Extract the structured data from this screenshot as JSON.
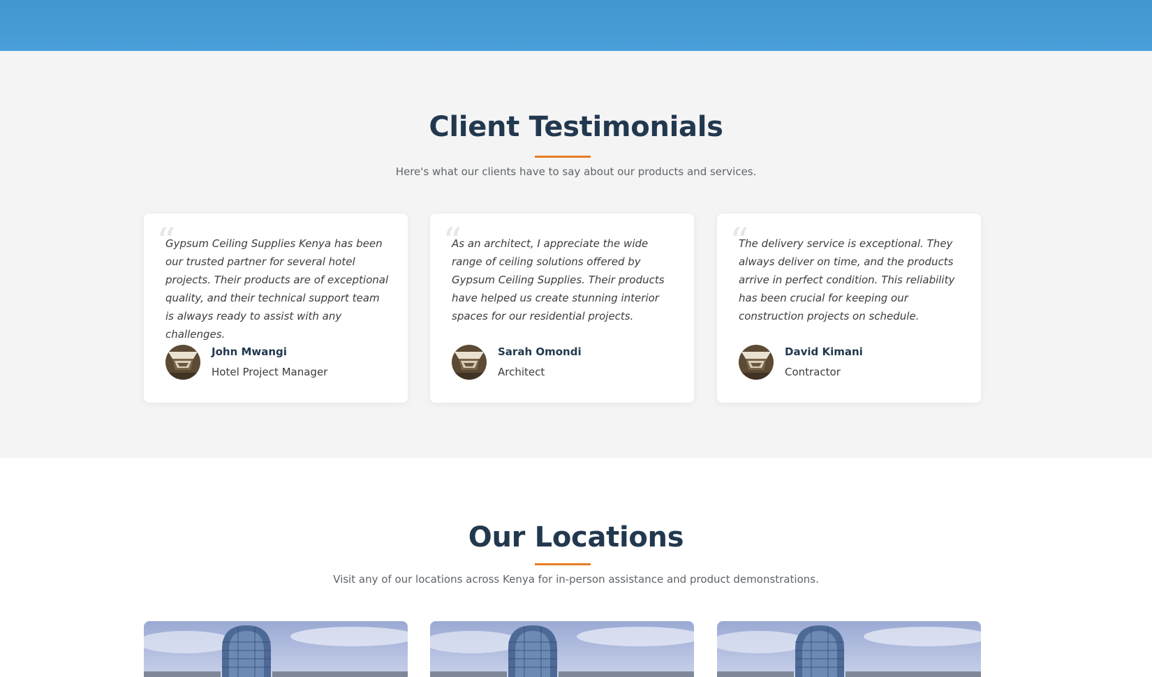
{
  "testimonials": {
    "title": "Client Testimonials",
    "subtitle": "Here's what our clients have to say about our products and services.",
    "items": [
      {
        "quote": "Gypsum Ceiling Supplies Kenya has been our trusted partner for several hotel projects. Their products are of exceptional quality, and their technical support team is always ready to assist with any challenges.",
        "name": "John Mwangi",
        "role": "Hotel Project Manager"
      },
      {
        "quote": "As an architect, I appreciate the wide range of ceiling solutions offered by Gypsum Ceiling Supplies. Their products have helped us create stunning interior spaces for our residential projects.",
        "name": "Sarah Omondi",
        "role": "Architect"
      },
      {
        "quote": "The delivery service is exceptional. They always deliver on time, and the products arrive in perfect condition. This reliability has been crucial for keeping our construction projects on schedule.",
        "name": "David Kimani",
        "role": "Contractor"
      }
    ]
  },
  "locations": {
    "title": "Our Locations",
    "subtitle": "Visit any of our locations across Kenya for in-person assistance and product demonstrations."
  },
  "colors": {
    "header_blue": "#4aa0da",
    "heading": "#22384f",
    "accent_orange": "#e67e22",
    "section_bg": "#f4f4f4"
  },
  "icons": {
    "quote": "quote-mark-icon",
    "avatar": "ceiling-avatar-image",
    "location_image": "building-photo"
  }
}
